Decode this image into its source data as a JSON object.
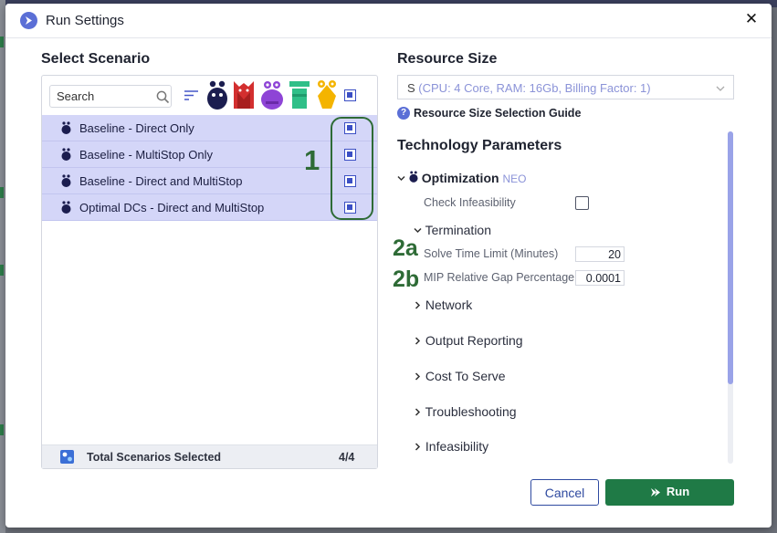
{
  "dialog": {
    "title": "Run Settings",
    "close_symbol": "✕",
    "cancel_label": "Cancel",
    "run_label": "Run"
  },
  "scenario": {
    "section_title": "Select Scenario",
    "search_placeholder": "Search",
    "items": [
      {
        "label": "Baseline - Direct Only",
        "selected": true
      },
      {
        "label": "Baseline - MultiStop Only",
        "selected": true
      },
      {
        "label": "Baseline - Direct and MultiStop",
        "selected": true
      },
      {
        "label": "Optimal DCs - Direct and MultiStop",
        "selected": true
      }
    ],
    "footer_label": "Total Scenarios Selected",
    "footer_count": "4/4",
    "filter_icons": [
      "neo-icon",
      "throg-icon",
      "dendro-icon",
      "hopper-icon",
      "triad-icon"
    ],
    "icon_colors": {
      "neo": "#1b1d4f",
      "throg": "#d32f2f",
      "dendro": "#8e44d6",
      "hopper": "#2fbf88",
      "triad": "#f4b400"
    }
  },
  "annotations": {
    "a1": "1",
    "a2a": "2a",
    "a2b": "2b"
  },
  "resource": {
    "section_title": "Resource Size",
    "selected_value": "S",
    "selected_detail": "(CPU: 4 Core, RAM: 16Gb, Billing Factor: 1)",
    "guide_link": "Resource Size Selection Guide"
  },
  "tech": {
    "section_title": "Technology Parameters",
    "optimization_label": "Optimization",
    "optimization_tag": "NEO",
    "check_infeasibility_label": "Check Infeasibility",
    "check_infeasibility_checked": false,
    "termination_label": "Termination",
    "solve_time_label": "Solve Time Limit (Minutes)",
    "solve_time_value": "20",
    "mip_gap_label": "MIP Relative Gap Percentage",
    "mip_gap_value": "0.0001",
    "groups": [
      "Network",
      "Output Reporting",
      "Cost To Serve",
      "Troubleshooting",
      "Infeasibility"
    ]
  },
  "colors": {
    "accent": "#5b6fd6",
    "run_green": "#1f7a46",
    "annotation_green": "#2e6b36",
    "selection": "#d4d6f8"
  }
}
